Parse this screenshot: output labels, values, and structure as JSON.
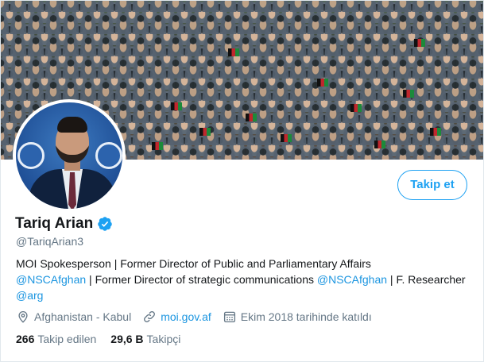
{
  "profile": {
    "name": "Tariq Arian",
    "handle": "@TariqArian3",
    "verified": true,
    "follow_label": "Takip et"
  },
  "bio": {
    "part1": "MOI Spokesperson | Former Director of Public and Parliamentary Affairs",
    "mention1": "@NSCAfghan",
    "part2": " | Former Director of strategic communications ",
    "mention2": "@NSCAfghan",
    "part3": " | F. Researcher ",
    "mention3": "@arg"
  },
  "meta": {
    "location": "Afghanistan - Kabul",
    "website": "moi.gov.af",
    "joined": "Ekim 2018 tarihinde katıldı"
  },
  "stats": {
    "following_count": "266",
    "following_label": "Takip edilen",
    "followers_count": "29,6 B",
    "followers_label": "Takipçi"
  },
  "colors": {
    "accent": "#1da1f2",
    "link": "#1b95e0",
    "secondary_text": "#657786",
    "primary_text": "#14171a"
  },
  "icons": [
    "verified-badge-icon",
    "location-pin-icon",
    "link-icon",
    "calendar-icon"
  ]
}
